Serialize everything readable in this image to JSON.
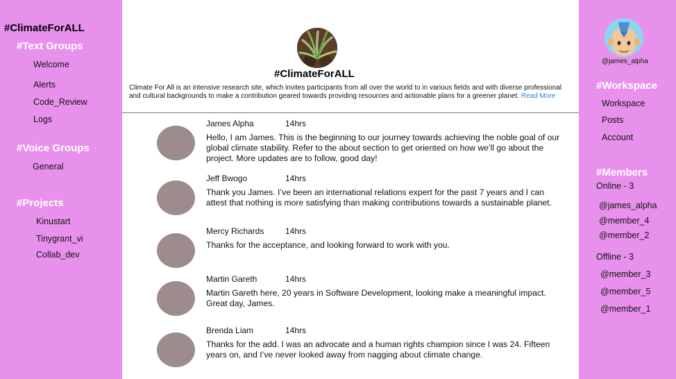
{
  "left_sidebar": {
    "server_title": "#ClimateForALL",
    "text_groups": {
      "heading": "#Text Groups",
      "items": [
        "Welcome",
        "Alerts",
        "Code_Review",
        "Logs"
      ]
    },
    "voice_groups": {
      "heading": "#Voice Groups",
      "items": [
        "General"
      ]
    },
    "projects": {
      "heading": "#Projects",
      "items": [
        "Kinustart",
        "Tinygrant_vi",
        "Collab_dev"
      ]
    }
  },
  "channel": {
    "title": "#ClimateForALL",
    "description": "Climate For All is an intensive research site, which invites participants from all over the world to in various fields and with diverse professional and cultural backgrounds to make a contribution geared towards providing resources and actionable plans for a greener planet.",
    "read_more": "Read More"
  },
  "messages": [
    {
      "author": "James Alpha",
      "time": "14hrs",
      "text": "Hello, I am James. This is the beginning to our  journey towards achieving the noble goal of our global climate stability. Refer to the about section to get oriented on how we’ll go about the project. More updates are to follow, good day!"
    },
    {
      "author": "Jeff Bwogo",
      "time": "14hrs",
      "text": "Thank you James. I’ve been an international relations expert for the past 7 years and I can attest that nothing is more  satisfying than making contributions towards a sustainable planet."
    },
    {
      "author": "Mercy Richards",
      "time": "14hrs",
      "text": "Thanks for the acceptance, and looking forward to work with you."
    },
    {
      "author": "Martin Gareth",
      "time": "14hrs",
      "text": "Martin Gareth here, 20 years in Software Development, looking make a meaningful impact. Great day, James."
    },
    {
      "author": "Brenda Liam",
      "time": "14hrs",
      "text": "Thanks for the add. I was an advocate and a human rights champion since I was 24. Fifteen years on, and I’ve never looked away from nagging about climate change."
    }
  ],
  "right_sidebar": {
    "user_handle": "@james_alpha",
    "workspace": {
      "heading": "#Workspace",
      "items": [
        "Workspace",
        "Posts",
        "Account"
      ]
    },
    "members": {
      "heading": "#Members",
      "online_label": "Online - 3",
      "online": [
        "@james_alpha",
        "@member_4",
        "@member_2"
      ],
      "offline_label": "Offline - 3",
      "offline": [
        "@member_3",
        "@member_5",
        "@member_1"
      ]
    }
  },
  "colors": {
    "sidebar_bg": "#e891ec",
    "section_heading": "#ffffff",
    "link": "#2f7fd8",
    "message_avatar": "#9e8b8b",
    "divider": "#7a7a7a"
  },
  "icons": {
    "channel_avatar": "spider-plant-icon",
    "user_avatar": "avatar-character-icon"
  }
}
